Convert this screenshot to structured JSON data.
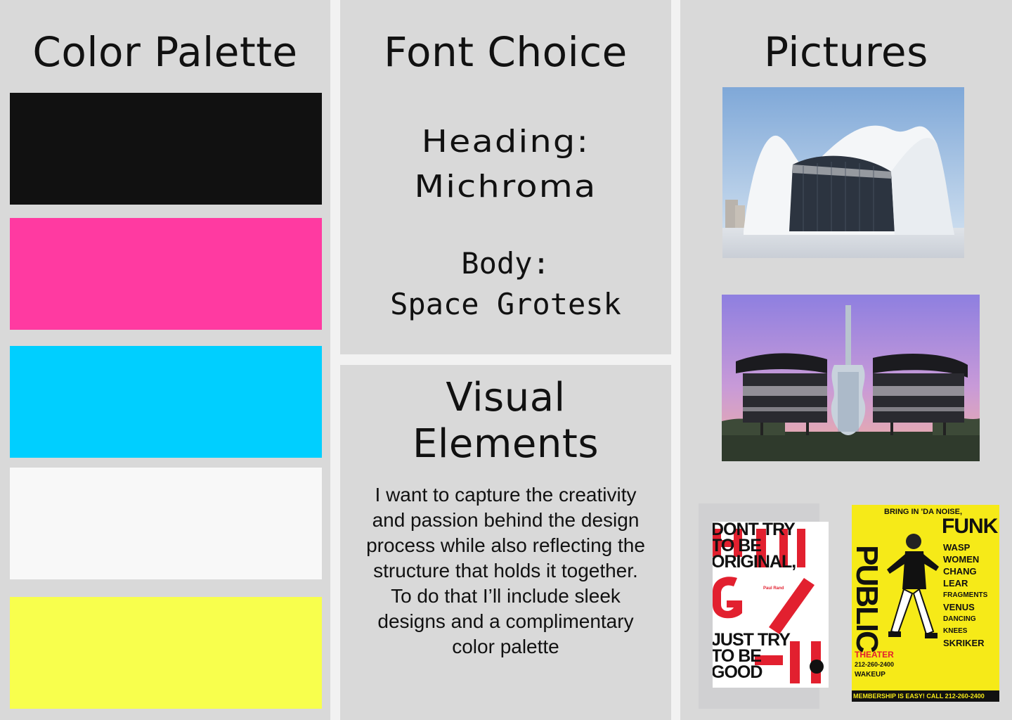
{
  "palette": {
    "title": "Color Palette",
    "swatches": [
      "#111111",
      "#ff3aa1",
      "#00cfff",
      "#f8f8f8",
      "#f8ff4d"
    ]
  },
  "font_choice": {
    "title": "Font Choice",
    "heading_label": "Heading:",
    "heading_font": "Michroma",
    "body_label": "Body:",
    "body_font": "Space Grotesk"
  },
  "visual_elements": {
    "title_line1": "Visual",
    "title_line2": "Elements",
    "description": "I want to capture the creativity and passion behind the design process while also reflecting the structure that holds it together. To do that I’ll include sleek designs and a complimentary color palette"
  },
  "pictures": {
    "title": "Pictures",
    "poster1": {
      "line1": "DONT TRY",
      "line2": "TO BE",
      "line3": "ORIGINAL,",
      "line4": "JUST TRY",
      "line5": "TO BE",
      "line6": "GOOD",
      "author": "Paul Rand"
    },
    "poster2": {
      "left_vertical": "PUBLIC",
      "top_text": "BRING IN 'DA NOISE,",
      "big_word": "FUNK",
      "words": [
        "WASP",
        "WOMEN",
        "CHANG",
        "LEAR",
        "FRAGMENTS",
        "VENUS",
        "DANCING KNEES",
        "SKRIKER",
        "WAKEUP"
      ],
      "theater": "THEATER",
      "phone": "212-260-2400",
      "footer": "MEMBERSHIP IS EASY! CALL 212-260-2400"
    }
  }
}
